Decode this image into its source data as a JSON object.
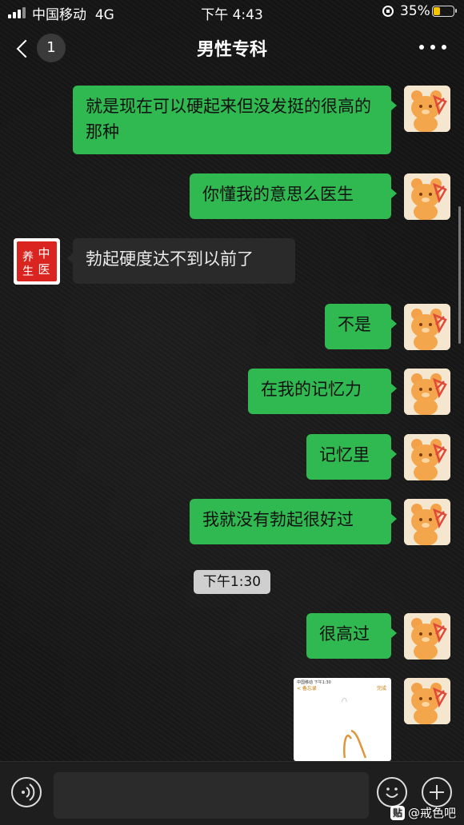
{
  "status_bar": {
    "carrier": "中国移动",
    "network": "4G",
    "time": "下午 4:43",
    "battery_percent_text": "35%",
    "battery_level": 0.35
  },
  "nav": {
    "unread_count": "1",
    "title": "男性专科"
  },
  "messages": [
    {
      "from": "me",
      "text": "就是现在可以硬起来但没发挺的很高的那种"
    },
    {
      "from": "me",
      "text": "你懂我的意思么医生"
    },
    {
      "from": "doctor",
      "text": "勃起硬度达不到以前了"
    },
    {
      "from": "me",
      "text": "不是"
    },
    {
      "from": "me",
      "text": "在我的记忆力"
    },
    {
      "from": "me",
      "text": "记忆里"
    },
    {
      "from": "me",
      "text": "我就没有勃起很好过"
    },
    {
      "from": "me",
      "text": "很高过"
    }
  ],
  "timestamp_chip": "下午1:30",
  "doctor_avatar_text": "中医养生",
  "image_message": {
    "status_text": "中国移动 下午1:30",
    "back_text": "< 备忘录",
    "done_text": "完成"
  },
  "watermark": {
    "badge": "贴",
    "text": "@戒色吧"
  },
  "colors": {
    "outgoing_bubble": "#2fb950",
    "incoming_bubble": "#2a2a2a",
    "background": "#151515"
  }
}
